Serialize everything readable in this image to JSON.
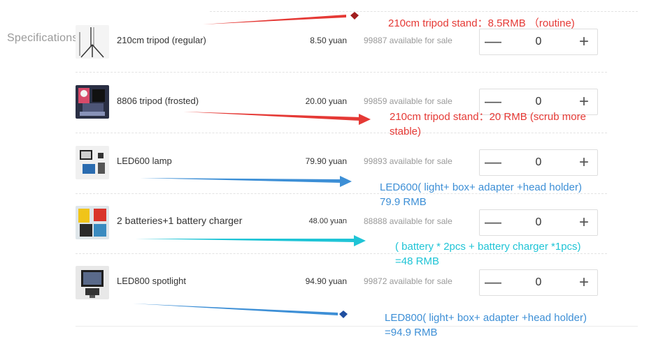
{
  "section_label": "Specifications",
  "products": [
    {
      "name": "210cm tripod (regular)",
      "price": "8.50 yuan",
      "availability": "99887 available for sale",
      "quantity": "0",
      "thumb": "tripod-image"
    },
    {
      "name": "8806 tripod (frosted)",
      "price": "20.00 yuan",
      "availability": "99859 available for sale",
      "quantity": "0",
      "thumb": "tripod-head-image"
    },
    {
      "name": "LED600 lamp",
      "price": "79.90 yuan",
      "availability": "99893 available for sale",
      "quantity": "0",
      "thumb": "led-lamp-image"
    },
    {
      "name": "2 batteries+1 battery charger",
      "price": "48.00 yuan",
      "availability": "88888 available for sale",
      "quantity": "0",
      "thumb": "battery-image"
    },
    {
      "name": "LED800 spotlight",
      "price": "94.90 yuan",
      "availability": "99872 available for sale",
      "quantity": "0",
      "thumb": "spotlight-image"
    }
  ],
  "stepper": {
    "minus": "—",
    "plus": "+"
  },
  "annotations": [
    {
      "lines": [
        "210cm tripod stand：8.5RMB （routine)"
      ],
      "color": "#e53935"
    },
    {
      "lines": [
        "210cm tripod stand：20 RMB (scrub more",
        "stable)"
      ],
      "color": "#e53935"
    },
    {
      "lines": [
        "LED600( light+ box+ adapter +head holder)",
        "79.9 RMB"
      ],
      "color": "#3d8fd6"
    },
    {
      "lines": [
        "( battery * 2pcs + battery charger *1pcs)",
        "=48 RMB"
      ],
      "color": "#1fc4d6"
    },
    {
      "lines": [
        "LED800( light+ box+ adapter +head holder)",
        "=94.9 RMB"
      ],
      "color": "#3d8fd6"
    }
  ]
}
